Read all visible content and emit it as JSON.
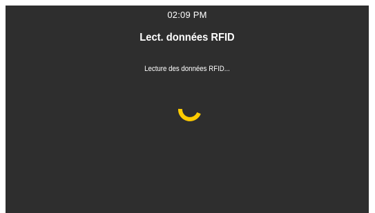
{
  "status_bar": {
    "time": "02:09 PM"
  },
  "screen": {
    "title": "Lect. données RFID",
    "message": "Lecture des données RFID..."
  },
  "spinner": {
    "icon": "loading-spinner-icon",
    "color": "#ffcc00"
  },
  "colors": {
    "background": "#2e2e2e",
    "text": "#ffffff",
    "accent": "#ffcc00"
  }
}
